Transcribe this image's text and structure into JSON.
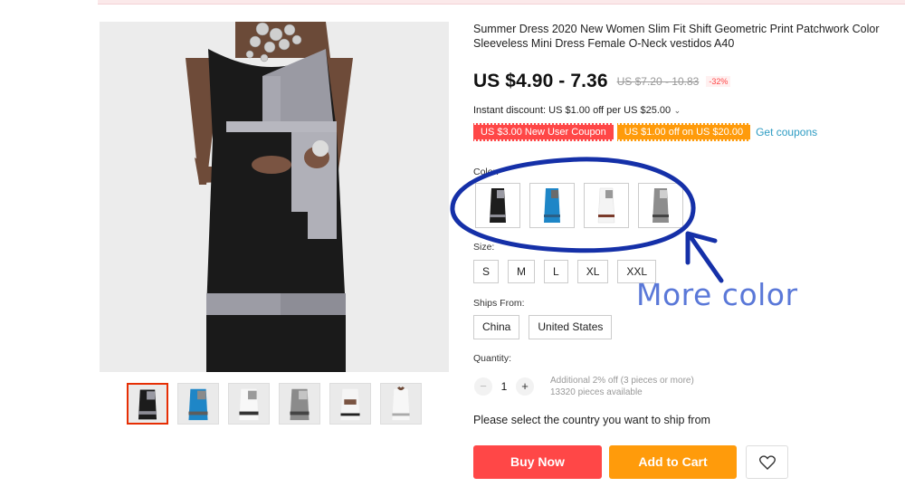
{
  "product": {
    "title": "Summer Dress 2020 New Women Slim Fit Shift Geometric Print Patchwork Color Sleeveless Mini Dress Female O-Neck vestidos A40"
  },
  "gallery": {
    "thumbnails": [
      {
        "name": "black-grey",
        "active": true
      },
      {
        "name": "blue"
      },
      {
        "name": "white"
      },
      {
        "name": "grey"
      },
      {
        "name": "white-front"
      },
      {
        "name": "white-back"
      }
    ]
  },
  "pricing": {
    "price": "US $4.90 - 7.36",
    "original_price": "US $7.20 - 10.83",
    "discount": "-32%",
    "instant_discount": "Instant discount: US $1.00 off per US $25.00",
    "accent_color": "#ff4747"
  },
  "coupons": {
    "items": [
      "US $3.00 New User Coupon",
      "US $1.00 off on US $20.00"
    ],
    "get_label": "Get coupons"
  },
  "color": {
    "label": "Color:",
    "options": [
      {
        "name": "black",
        "fill": "#1d1d1d"
      },
      {
        "name": "blue",
        "fill": "#1e86c7"
      },
      {
        "name": "white",
        "fill": "#f4f4f4"
      },
      {
        "name": "grey",
        "fill": "#8d8d8d"
      }
    ]
  },
  "size": {
    "label": "Size:",
    "options": [
      "S",
      "M",
      "L",
      "XL",
      "XXL"
    ]
  },
  "ships_from": {
    "label": "Ships From:",
    "options": [
      "China",
      "United States"
    ]
  },
  "quantity": {
    "label": "Quantity:",
    "value": "1",
    "minus": "−",
    "plus": "+",
    "note_line1": "Additional 2% off (3 pieces or more)",
    "note_line2": "13320 pieces available"
  },
  "ship_prompt": "Please select the country you want to ship from",
  "actions": {
    "buy_now": "Buy Now",
    "add_to_cart": "Add to Cart",
    "wishlist_icon": "heart-icon"
  },
  "annotation": {
    "text": "More color",
    "color": "#1530a8"
  }
}
